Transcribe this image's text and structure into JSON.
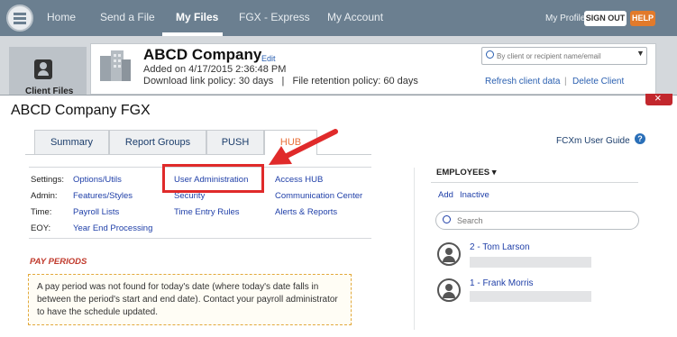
{
  "nav": {
    "items": [
      "Home",
      "Send a File",
      "My Files",
      "FGX - Express",
      "My Account"
    ],
    "active": "My Files",
    "profile": "My Profile",
    "signout": "SIGN OUT",
    "help": "HELP"
  },
  "client": {
    "sidebar_label": "Client Files",
    "company_name": "ABCD Company",
    "edit": "Edit",
    "added_on": "Added on 4/17/2015 2:36:48 PM",
    "policy": "Download link policy: 30 days   |   File retention policy: 60 days",
    "search_placeholder": "By client or recipient name/email",
    "refresh": "Refresh client data",
    "separator": "|",
    "delete": "Delete Client"
  },
  "modal": {
    "title": "ABCD Company FGX",
    "tabs": [
      "Summary",
      "Report Groups",
      "PUSH",
      "HUB"
    ],
    "active_tab": "HUB",
    "guide": "FCXm User Guide",
    "help_glyph": "?",
    "settings": {
      "labels": [
        "Settings:",
        "Admin:",
        "Time:",
        "EOY:"
      ],
      "col1": [
        "Options/Utils",
        "Features/Styles",
        "Payroll Lists",
        "Year End Processing"
      ],
      "col2": [
        "User Administration",
        "Security",
        "Time Entry Rules"
      ],
      "col3": [
        "Access HUB",
        "Communication Center",
        "Alerts & Reports"
      ]
    },
    "pay_periods": {
      "title": "PAY PERIODS",
      "message": "A pay period was not found for today's date (where today's date falls in between the period's start and end date). Contact your payroll administrator to have the schedule updated."
    },
    "employees": {
      "title": "EMPLOYEES ▾",
      "add": "Add",
      "inactive": "Inactive",
      "search_placeholder": "Search",
      "list": [
        {
          "name": "2 - Tom Larson"
        },
        {
          "name": "1 - Frank Morris"
        }
      ]
    }
  },
  "colors": {
    "nav_bg": "#6b7f90",
    "highlight": "#e02a2a",
    "active_tab": "#e8703a",
    "link": "#1f3fa8"
  }
}
